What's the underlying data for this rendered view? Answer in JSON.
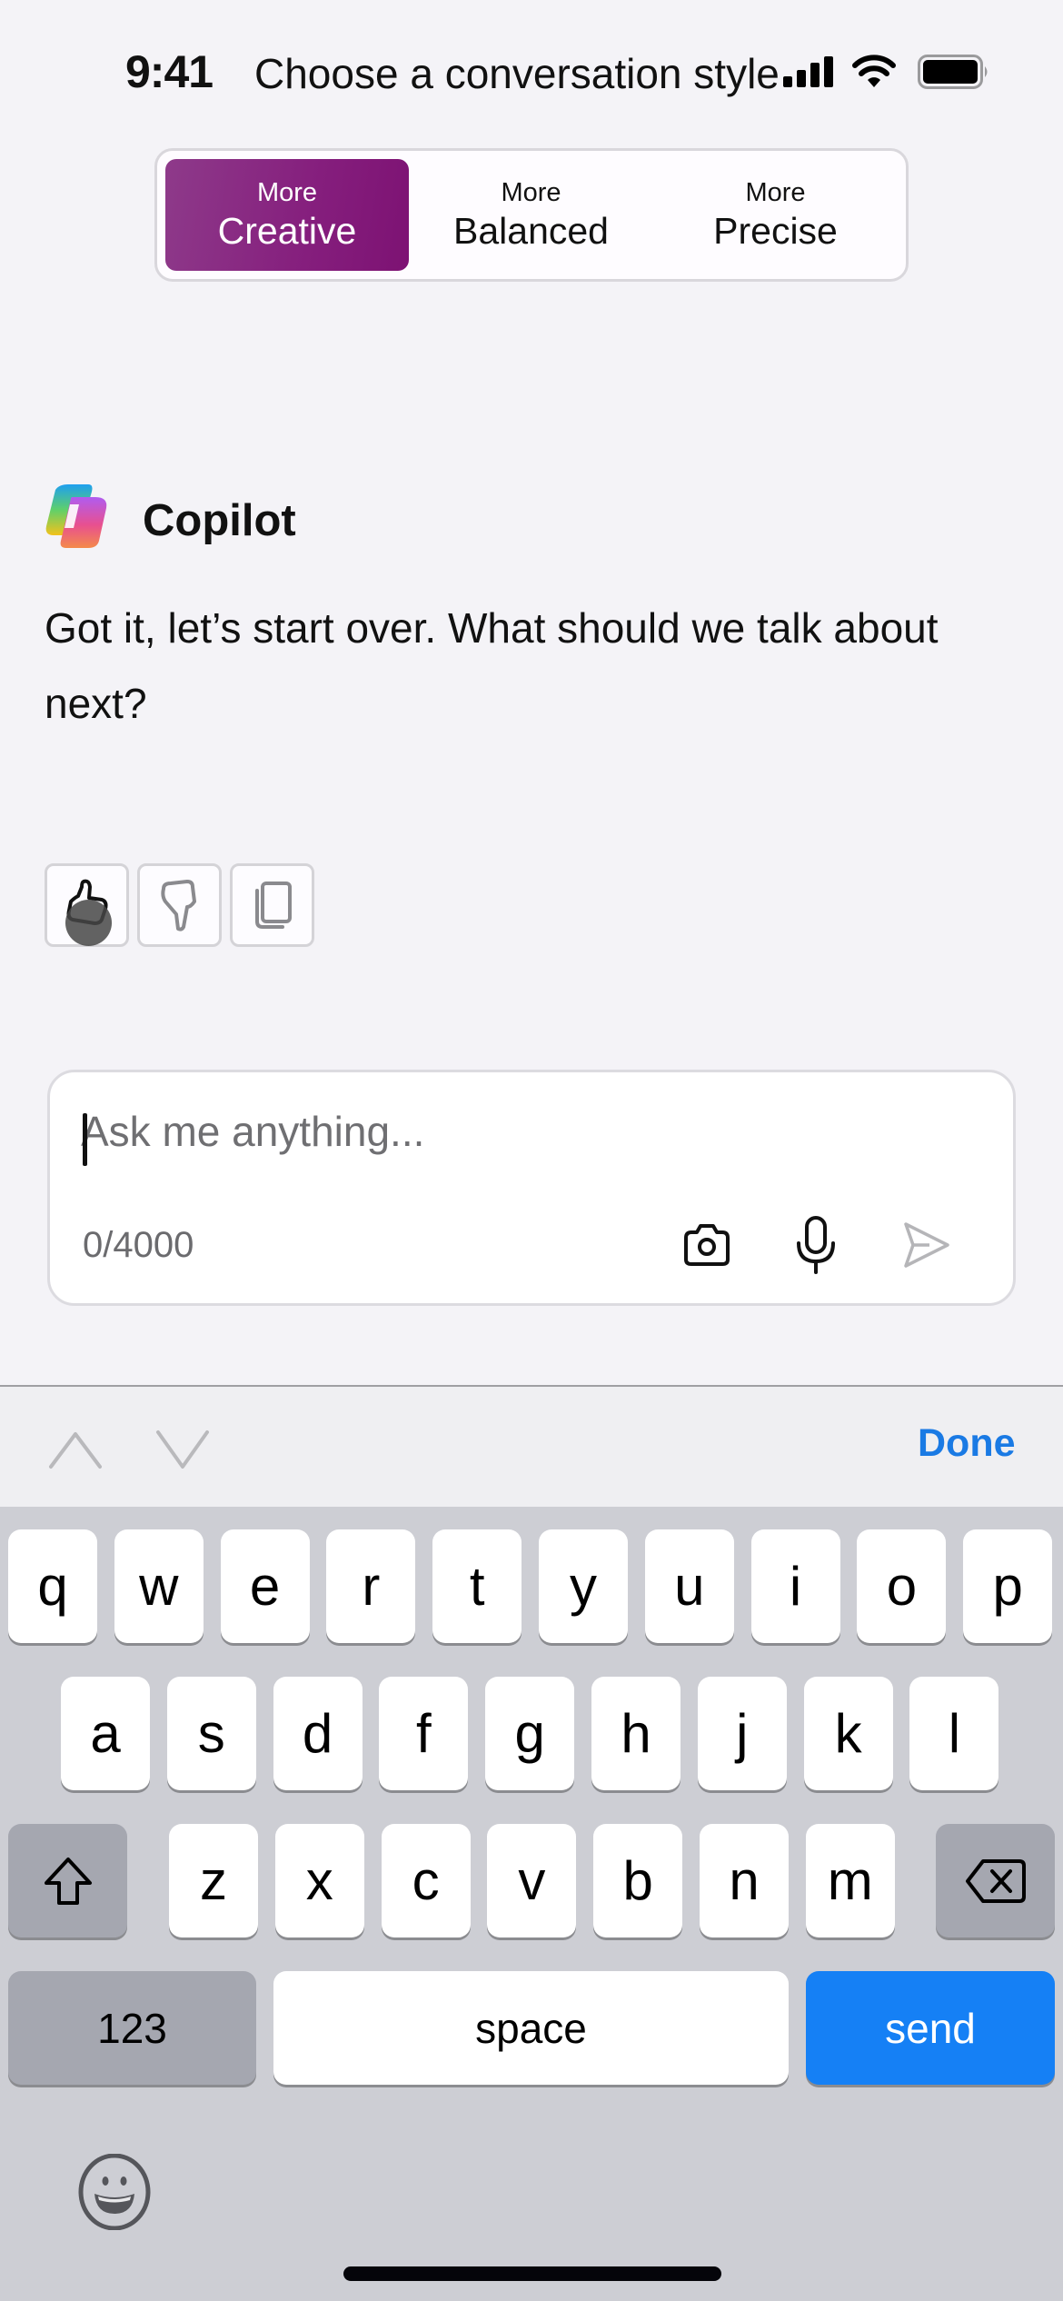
{
  "status_bar": {
    "time": "9:41",
    "title": "Choose a conversation style",
    "icons": [
      "signal-icon",
      "wifi-icon",
      "battery-icon"
    ]
  },
  "conversation_style": {
    "options": [
      {
        "prefix": "More",
        "label": "Creative",
        "selected": true
      },
      {
        "prefix": "More",
        "label": "Balanced",
        "selected": false
      },
      {
        "prefix": "More",
        "label": "Precise",
        "selected": false
      }
    ],
    "selected_color": "#851e7d"
  },
  "assistant": {
    "name": "Copilot",
    "message": "Got it, let’s start over. What should we talk about next?"
  },
  "feedback": {
    "buttons": [
      "thumbs-up-icon",
      "thumbs-down-icon",
      "copy-icon"
    ]
  },
  "composer": {
    "placeholder": "Ask me anything...",
    "value": "",
    "char_count": "0/4000",
    "icons": [
      "camera-icon",
      "microphone-icon",
      "send-icon"
    ]
  },
  "accessory_bar": {
    "done_label": "Done",
    "done_color": "#1a7ae4"
  },
  "keyboard": {
    "row1": [
      "q",
      "w",
      "e",
      "r",
      "t",
      "y",
      "u",
      "i",
      "o",
      "p"
    ],
    "row2": [
      "a",
      "s",
      "d",
      "f",
      "g",
      "h",
      "j",
      "k",
      "l"
    ],
    "row3": [
      "z",
      "x",
      "c",
      "v",
      "b",
      "n",
      "m"
    ],
    "numbers_label": "123",
    "space_label": "space",
    "return_label": "send",
    "return_color": "#1580f5"
  }
}
